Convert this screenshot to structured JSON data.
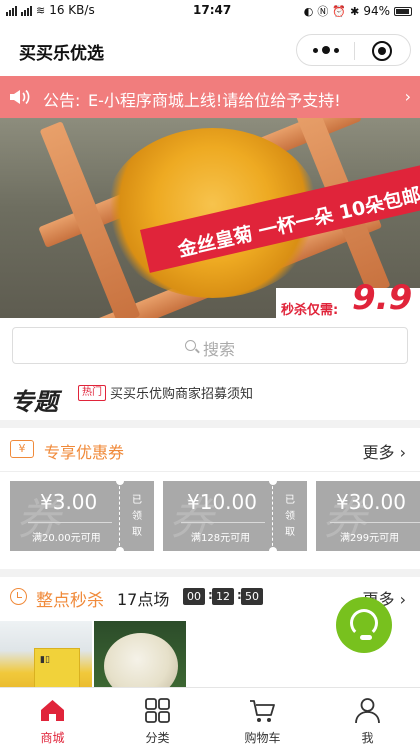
{
  "status_bar": {
    "network": "16 KB/s",
    "time": "17:47",
    "battery": "94%"
  },
  "nav": {
    "title": "买买乐优选"
  },
  "notice": {
    "label": "公告:",
    "text": "E-小程序商城上线!请给位给予支持!"
  },
  "banner": {
    "headline": "金丝皇菊 一杯一朵 10朵包邮",
    "price_label": "秒杀仅需:",
    "price": "9.9"
  },
  "search": {
    "placeholder": "搜索"
  },
  "topic": {
    "title": "专题",
    "tag": "热门",
    "text": "买买乐优购商家招募须知"
  },
  "coupon_section": {
    "title": "专享优惠券",
    "more": "更多",
    "coupons": [
      {
        "amount": "¥3.00",
        "condition": "满20.00元可用",
        "status": "已领取"
      },
      {
        "amount": "¥10.00",
        "condition": "满128元可用",
        "status": "已领取"
      },
      {
        "amount": "¥30.00",
        "condition": "满299元可用",
        "status": ""
      }
    ]
  },
  "flash_sale": {
    "title": "整点秒杀",
    "session": "17点场",
    "countdown": {
      "h": "00",
      "m": "12",
      "s": "50"
    },
    "more": "更多"
  },
  "tabbar": {
    "items": [
      {
        "label": "商城",
        "icon": "home-icon",
        "active": true
      },
      {
        "label": "分类",
        "icon": "category-icon",
        "active": false
      },
      {
        "label": "购物车",
        "icon": "cart-icon",
        "active": false
      },
      {
        "label": "我",
        "icon": "user-icon",
        "active": false
      }
    ]
  },
  "colors": {
    "accent": "#e0243a",
    "notice_bg": "#f17d7d",
    "orange": "#f08a3a",
    "coupon_gray": "#a9a9a9",
    "service_green": "#78c11e"
  }
}
